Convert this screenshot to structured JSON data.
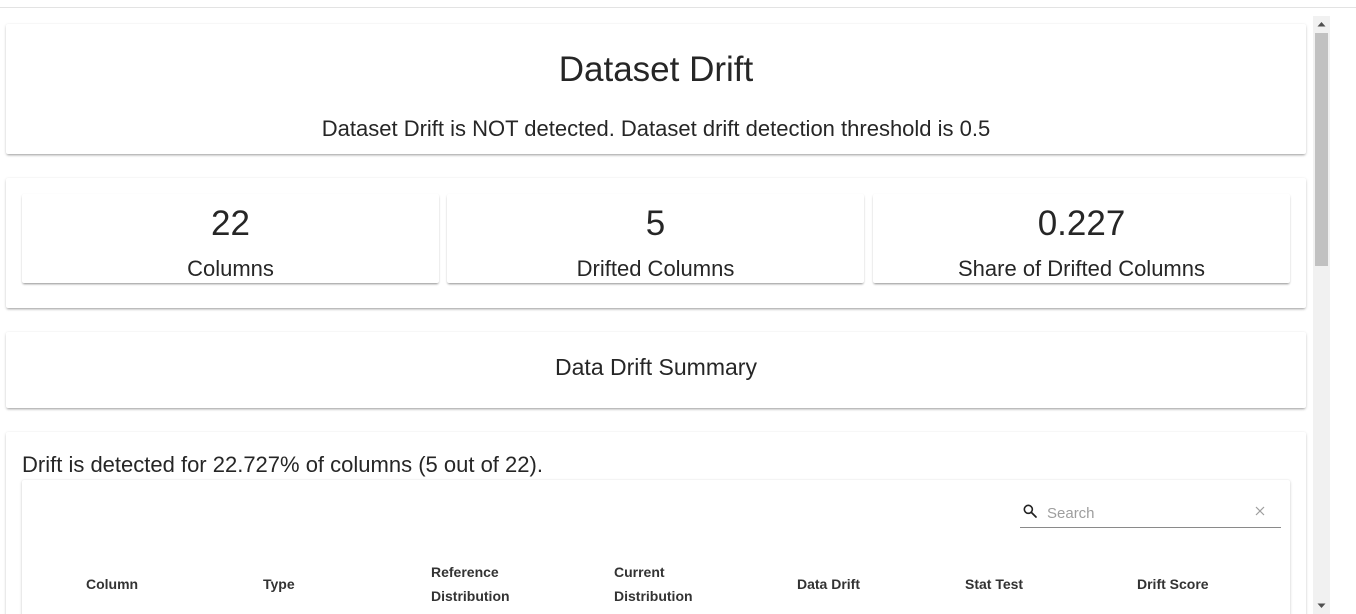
{
  "dataset_drift": {
    "title": "Dataset Drift",
    "subtitle": "Dataset Drift is NOT detected. Dataset drift detection threshold is 0.5"
  },
  "counters": [
    {
      "value": "22",
      "label": "Columns"
    },
    {
      "value": "5",
      "label": "Drifted Columns"
    },
    {
      "value": "0.227",
      "label": "Share of Drifted Columns"
    }
  ],
  "summary": {
    "title": "Data Drift Summary"
  },
  "table": {
    "caption": "Drift is detected for 22.727% of columns (5 out of 22).",
    "search_placeholder": "Search",
    "columns": [
      {
        "line1": "Column",
        "line2": ""
      },
      {
        "line1": "Type",
        "line2": ""
      },
      {
        "line1": "Reference",
        "line2": "Distribution"
      },
      {
        "line1": "Current",
        "line2": "Distribution"
      },
      {
        "line1": "Data Drift",
        "line2": ""
      },
      {
        "line1": "Stat Test",
        "line2": ""
      },
      {
        "line1": "Drift Score",
        "line2": ""
      }
    ]
  },
  "icons": {
    "search": "search-icon",
    "clear": "close-icon"
  },
  "colors": {
    "text": "#262626",
    "scrollbar_thumb": "#c1c1c1"
  }
}
